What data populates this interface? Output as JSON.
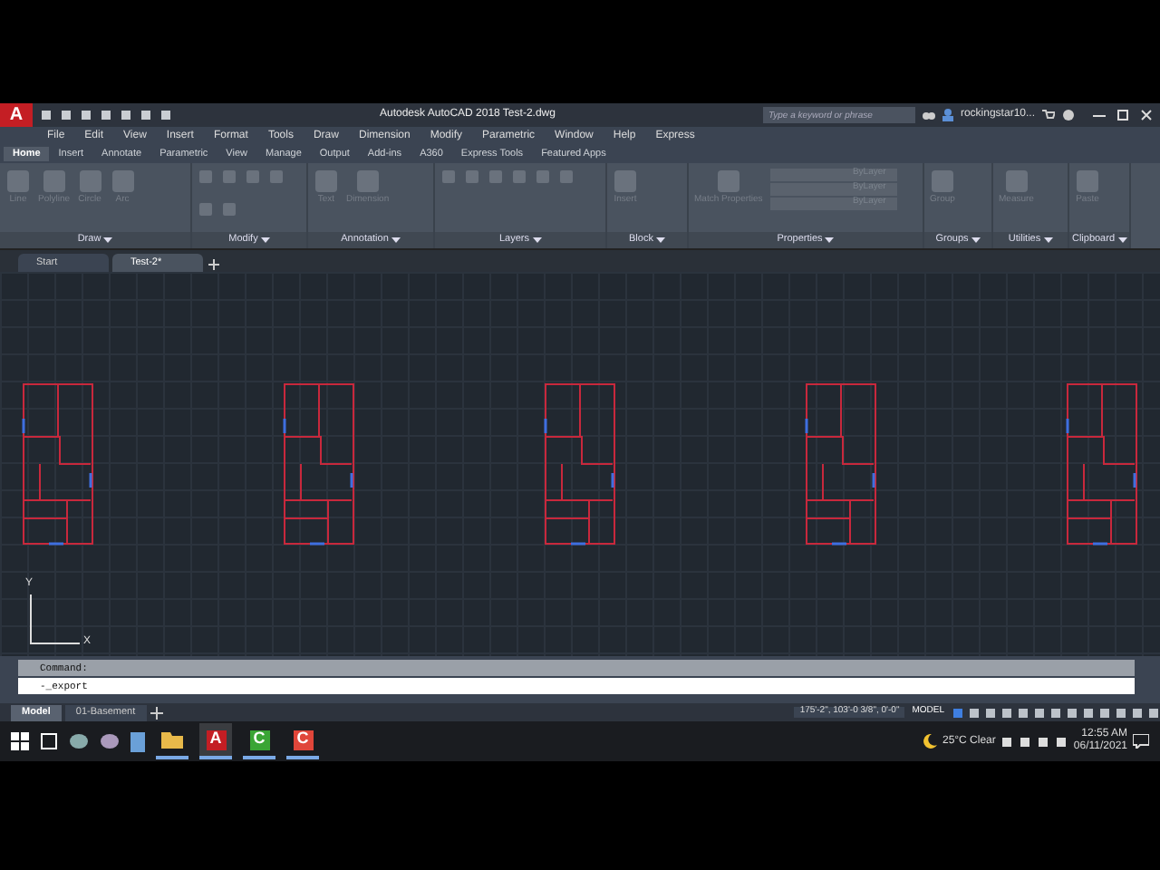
{
  "title_bar": {
    "logo": "A",
    "app_title": "Autodesk AutoCAD 2018",
    "file_name": "Test-2.dwg",
    "search": {
      "placeholder": "Type a keyword or phrase"
    },
    "user": "rockingstar10..."
  },
  "menu_bar": [
    "File",
    "Edit",
    "View",
    "Insert",
    "Format",
    "Tools",
    "Draw",
    "Dimension",
    "Modify",
    "Parametric",
    "Window",
    "Help",
    "Express"
  ],
  "ribbon_tabs": [
    {
      "label": "Home",
      "selected": true
    },
    {
      "label": "Insert",
      "selected": false
    },
    {
      "label": "Annotate",
      "selected": false
    },
    {
      "label": "Parametric",
      "selected": false
    },
    {
      "label": "View",
      "selected": false
    },
    {
      "label": "Manage",
      "selected": false
    },
    {
      "label": "Output",
      "selected": false
    },
    {
      "label": "Add-ins",
      "selected": false
    },
    {
      "label": "A360",
      "selected": false
    },
    {
      "label": "Express Tools",
      "selected": false
    },
    {
      "label": "Featured Apps",
      "selected": false
    }
  ],
  "ribbon_panels": [
    {
      "title": "Draw",
      "tools": [
        "Line",
        "Polyline",
        "Circle",
        "Arc"
      ]
    },
    {
      "title": "Modify"
    },
    {
      "title": "Annotation",
      "tools": [
        "Text",
        "Dimension"
      ]
    },
    {
      "title": "Layers"
    },
    {
      "title": "Block",
      "tools": [
        "Insert"
      ]
    },
    {
      "title": "Properties",
      "tools": [
        "Match Properties"
      ],
      "dropdowns": [
        "ByLayer",
        "ByLayer",
        "ByLayer"
      ]
    },
    {
      "title": "Groups",
      "tools": [
        "Group"
      ]
    },
    {
      "title": "Utilities",
      "tools": [
        "Measure"
      ]
    },
    {
      "title": "Clipboard",
      "tools": [
        "Paste"
      ]
    }
  ],
  "file_tabs": [
    {
      "label": "Start",
      "selected": false
    },
    {
      "label": "Test-2*",
      "selected": true
    }
  ],
  "ucs": {
    "y_label": "Y",
    "x_label": "X"
  },
  "command_line": {
    "history": "Command:",
    "input": "-_export"
  },
  "layout_tabs": [
    {
      "label": "Model",
      "selected": true
    },
    {
      "label": "01-Basement",
      "selected": false
    }
  ],
  "status_bar": {
    "coordinates": "175'-2\", 103'-0 3/8\", 0'-0\"",
    "space": "MODEL"
  },
  "taskbar": {
    "apps": [
      {
        "kind": "folder",
        "running": true,
        "selected": false
      },
      {
        "kind": "cad",
        "glyph": "A",
        "running": true,
        "selected": true
      },
      {
        "kind": "green",
        "glyph": "C",
        "running": true,
        "selected": false
      },
      {
        "kind": "red",
        "glyph": "C",
        "running": true,
        "selected": false
      }
    ],
    "weather": "25°C Clear",
    "time": "12:55 AM",
    "date": "06/11/2021"
  }
}
